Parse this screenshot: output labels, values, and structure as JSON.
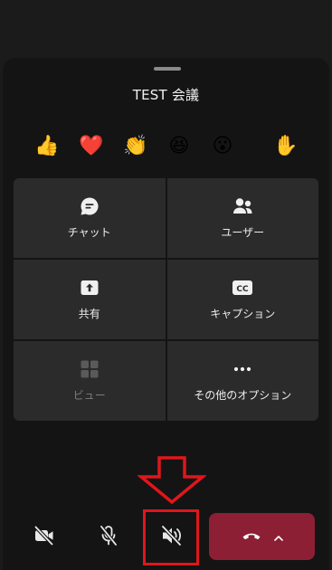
{
  "meeting": {
    "title": "TEST 会議"
  },
  "reactions": [
    {
      "name": "like",
      "glyph": "👍"
    },
    {
      "name": "heart",
      "glyph": "❤️"
    },
    {
      "name": "applause",
      "glyph": "👏"
    },
    {
      "name": "laugh",
      "glyph": "😆"
    },
    {
      "name": "surprised",
      "glyph": "😮"
    },
    {
      "name": "raise-hand",
      "glyph": "✋"
    }
  ],
  "menu": {
    "chat": "チャット",
    "users": "ユーザー",
    "share": "共有",
    "captions": "キャプション",
    "view": "ビュー",
    "more_options": "その他のオプション"
  },
  "icons": {
    "chat": "chat-bubble-icon",
    "users": "people-icon",
    "share": "share-tray-icon",
    "captions": "cc-icon",
    "view": "grid-view-icon",
    "more_options": "ellipsis-icon",
    "camera": "camera-off-icon",
    "mic": "mic-off-icon",
    "speaker": "speaker-off-icon",
    "hangup": "phone-hangup-icon",
    "hangup_more": "chevron-up-icon"
  },
  "colors": {
    "hangup": "#8c1f33",
    "highlight": "#e0161b",
    "tile": "#2b2b2b",
    "sheet": "#141414"
  }
}
